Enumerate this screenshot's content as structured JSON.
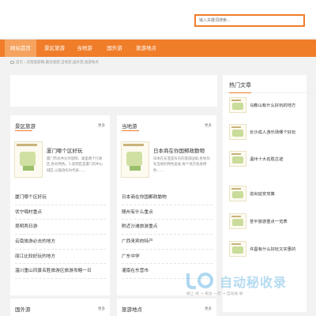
{
  "search": {
    "placeholder": "输入关键词搜索..."
  },
  "nav": {
    "items": [
      "网站首页",
      "景区旅游",
      "当地游",
      "国外游",
      "旅游地点"
    ]
  },
  "breadcrumb": "首页 › 云南旅游网,最近旅游,当地游,国外游,旅游地点",
  "sections": [
    {
      "title": "景区旅游",
      "more": "更多",
      "featured": {
        "title": "厦门哪个区好玩",
        "desc": "厦门市总共分为思明、湖里两个行政区,各有特色。1.思明区是厦门的中心城区,以鼓浪屿为代表……"
      },
      "list": [
        "厦门哪个区好玩",
        "伏宁喃村重点",
        "昆明两日游",
        "云南旅游必去的地方",
        "丽江比较好玩的地方",
        "温川重山风景名胜旅游区旅游攻略一日"
      ]
    },
    {
      "title": "当地游",
      "more": "更多",
      "featured": {
        "title": "日本商在你国郵政動物",
        "desc": "日本在东亚是有名的旅游国家,各地均有当地的特色美食,每个地方各具特色……"
      },
      "list": [
        "日本商在你国郵政動物",
        "随州有什么重点",
        "附近沙滩旅游重点",
        "广西来宾的特产",
        "广东中学",
        "灌南在东营市"
      ]
    }
  ],
  "lower_sections": [
    {
      "title": "国外游",
      "more": "更多"
    },
    {
      "title": "旅游地点",
      "more": "更多"
    }
  ],
  "hot": {
    "title": "热门文章",
    "items": [
      "马鞍山有什么好玩的地方",
      "长沙成人游乐场哪个好玩",
      "温州十大名胜古迹",
      "进出延安攻策",
      "苍平旅游重点一览表",
      "许昌有什么好玩又实惠的"
    ]
  },
  "watermark": {
    "brand": "自动秘收录",
    "tagline": "做上 线 → 来访 一次 → 自动收 录"
  },
  "colors": {
    "accent": "#f07d2a"
  }
}
